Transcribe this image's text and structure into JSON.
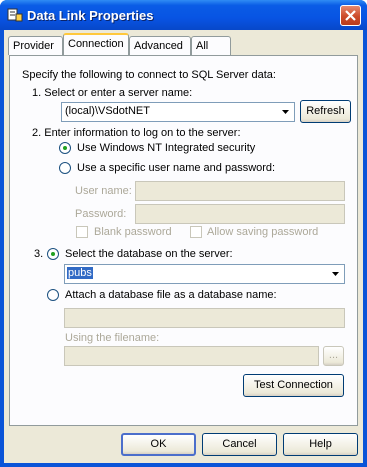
{
  "window": {
    "title": "Data Link Properties"
  },
  "tabs": [
    "Provider",
    "Connection",
    "Advanced",
    "All"
  ],
  "active_tab": "Connection",
  "connection": {
    "intro": "Specify the following to connect to SQL Server data:",
    "step1_label": "1. Select or enter a server name:",
    "server_value": "(local)\\VSdotNET",
    "refresh_label": "Refresh",
    "step2_label": "2. Enter information to log on to the server:",
    "nt_security_label": "Use Windows NT Integrated security",
    "specific_user_label": "Use a specific user name and password:",
    "username_label": "User name:",
    "password_label": "Password:",
    "blank_password_label": "Blank password",
    "allow_saving_label": "Allow saving password",
    "step3_number": "3.",
    "select_db_label": "Select the database on the server:",
    "database_value": "pubs",
    "attach_label": "Attach a database file as a database name:",
    "using_filename_label": "Using the filename:",
    "browse_label": "...",
    "test_label": "Test Connection"
  },
  "footer": {
    "ok": "OK",
    "cancel": "Cancel",
    "help": "Help"
  },
  "colors": {
    "titlebar": "#0a54d8",
    "dialog_bg": "#ece9d8",
    "panel_bg": "#fcfcfe",
    "selection": "#316ac5"
  }
}
